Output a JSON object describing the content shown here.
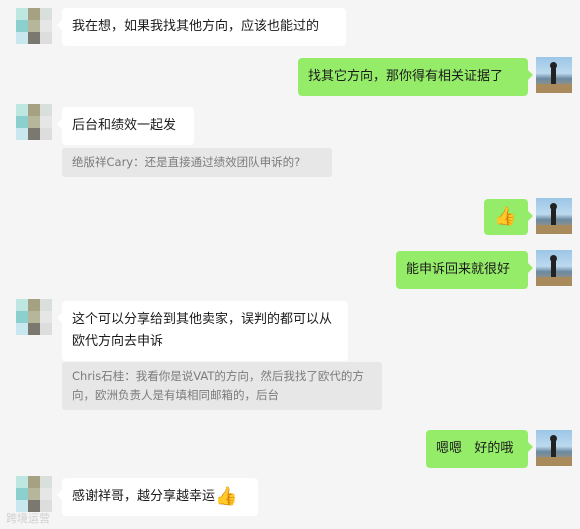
{
  "messages": [
    {
      "side": "left",
      "text": "我在想，如果我找其他方向，应该也能过的"
    },
    {
      "side": "right",
      "text": "找其它方向，那你得有相关证据了"
    },
    {
      "side": "left",
      "text": "后台和绩效一起发"
    },
    {
      "quote": "绝版祥Cary：还是直接通过绩效团队申诉的?"
    },
    {
      "side": "right",
      "emoji": "thumbs-up"
    },
    {
      "side": "right",
      "text": "能申诉回来就很好"
    },
    {
      "side": "left",
      "text": "这个可以分享给到其他卖家，误判的都可以从欧代方向去申诉"
    },
    {
      "quote": "Chris石桂：我看你是说VAT的方向，然后我找了欧代的方向，欧洲负责人是有填相同邮箱的，后台"
    },
    {
      "side": "right",
      "text": "嗯嗯   好的哦"
    },
    {
      "side": "left",
      "text": "感谢祥哥，越分享越幸运",
      "emoji": "thumbs-up"
    }
  ],
  "emoji_glyph": "👍",
  "watermark": "跨境运营"
}
